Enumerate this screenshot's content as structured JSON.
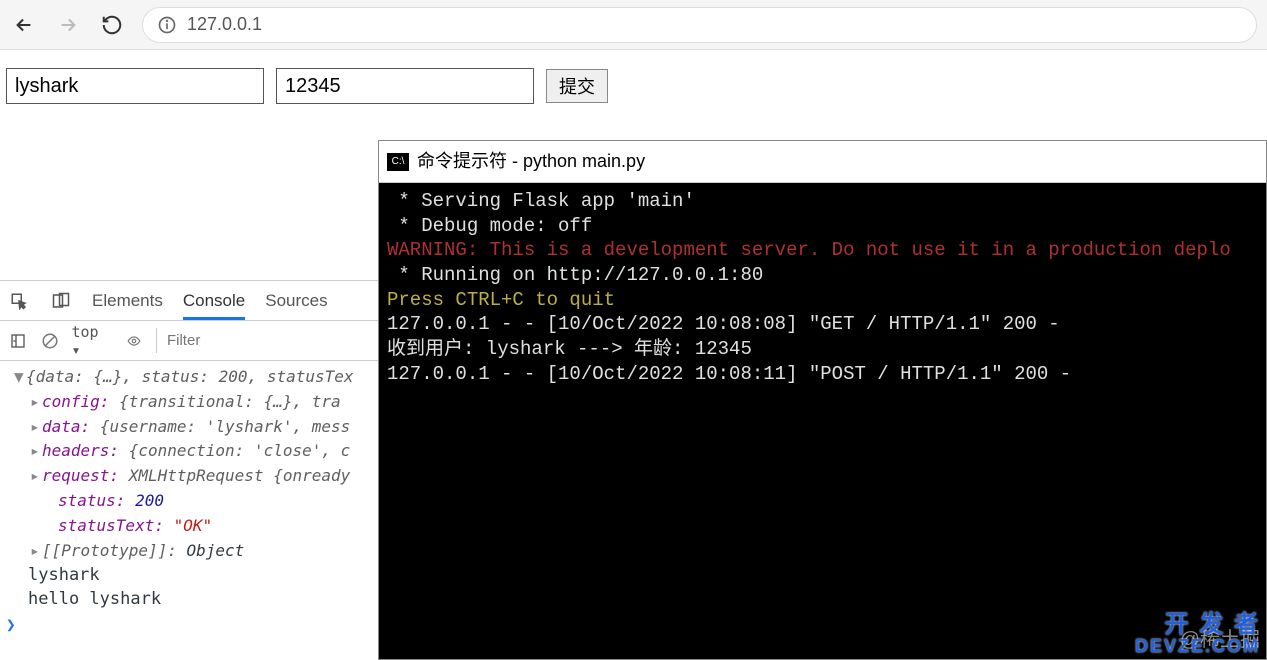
{
  "browser": {
    "url": "127.0.0.1"
  },
  "form": {
    "input1": "lyshark",
    "input2": "12345",
    "submit_label": "提交"
  },
  "terminal": {
    "title": "命令提示符 - python  main.py",
    "lines": [
      {
        "cls": "tl-white",
        "text": " * Serving Flask app 'main'"
      },
      {
        "cls": "tl-white",
        "text": " * Debug mode: off"
      },
      {
        "cls": "tl-red",
        "text": "WARNING: This is a development server. Do not use it in a production deplo"
      },
      {
        "cls": "tl-white",
        "text": " * Running on http://127.0.0.1:80"
      },
      {
        "cls": "tl-yellow",
        "text": "Press CTRL+C to quit"
      },
      {
        "cls": "tl-white",
        "text": "127.0.0.1 - - [10/Oct/2022 10:08:08] \"GET / HTTP/1.1\" 200 -"
      },
      {
        "cls": "tl-white",
        "text": "收到用户: lyshark ---> 年龄: 12345"
      },
      {
        "cls": "tl-white",
        "text": "127.0.0.1 - - [10/Oct/2022 10:08:11] \"POST / HTTP/1.1\" 200 -"
      }
    ],
    "watermark": "@稀土掘",
    "devze": "开 发 者\nDEVZE.COM"
  },
  "devtools": {
    "tabs": {
      "elements": "Elements",
      "console": "Console",
      "sources": "Sources"
    },
    "exec_context": "top",
    "filter_placeholder": "Filter",
    "object": {
      "summary_open": "{data: {…}, status: 200, statusTex",
      "config_label": "config:",
      "config_val": "{transitional: {…}, tra",
      "data_label": "data:",
      "data_val": "{username: 'lyshark', mess",
      "headers_label": "headers:",
      "headers_val": "{connection: 'close', c",
      "request_label": "request:",
      "request_val": "XMLHttpRequest {onready",
      "status_label": "status:",
      "status_val": "200",
      "statusText_label": "statusText:",
      "statusText_val": "\"OK\"",
      "proto_label": "[[Prototype]]:",
      "proto_val": "Object"
    },
    "logs": [
      "lyshark",
      "hello lyshark"
    ]
  }
}
